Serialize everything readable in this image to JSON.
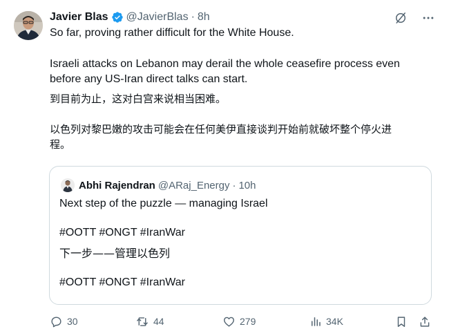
{
  "tweet": {
    "author_name": "Javier Blas",
    "author_handle": "@JavierBlas",
    "separator": "·",
    "time": "8h",
    "verified_icon": "verified-badge-icon",
    "lines": [
      "So far, proving rather difficult for the White House.",
      "Israeli attacks on Lebanon may derail the whole ceasefire process even",
      "before any US-Iran direct talks can start.",
      "到目前为止，这对白宫来说相当困难。",
      "以色列对黎巴嫩的攻击可能会在任何美伊直接谈判开始前就破坏整个停火进",
      "程。"
    ]
  },
  "quote": {
    "author_name": "Abhi Rajendran",
    "author_handle": "@ARaj_Energy",
    "separator": "·",
    "time": "10h",
    "lines": [
      "Next step of the puzzle — managing Israel",
      "#OOTT #ONGT #IranWar",
      "下一步——管理以色列",
      "#OOTT #ONGT #IranWar"
    ]
  },
  "actions": {
    "replies": "30",
    "reposts": "44",
    "likes": "279",
    "views": "34K"
  },
  "colors": {
    "text": "#0f1419",
    "secondary": "#536471",
    "verified": "#1d9bf0",
    "border": "#cfd9de"
  }
}
